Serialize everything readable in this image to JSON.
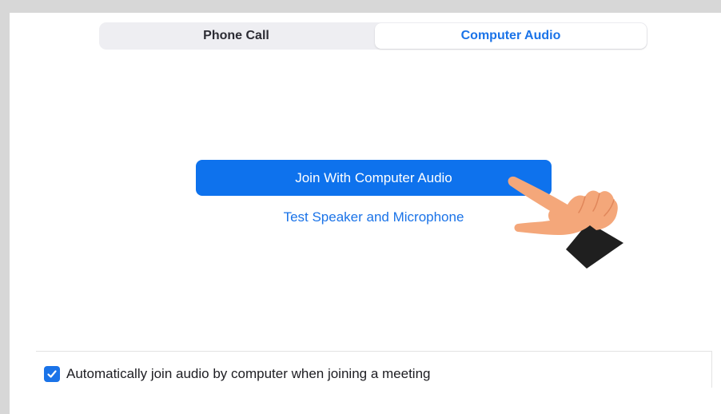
{
  "tabs": {
    "phone_call": "Phone Call",
    "computer_audio": "Computer Audio",
    "selected": "Computer Audio"
  },
  "main": {
    "join_button_label": "Join With Computer Audio",
    "test_link_label": "Test Speaker and Microphone"
  },
  "footer": {
    "auto_join_checked": true,
    "auto_join_label": "Automatically join audio by computer when joining a meeting"
  },
  "colors": {
    "accent": "#0e72ed",
    "link": "#1a73e8",
    "tab_bg": "#eeeef2",
    "hand_skin": "#f4a77a",
    "cuff": "#1f1f1f"
  },
  "icons": {
    "checkbox": "checkmark-icon",
    "pointer": "pointing-hand-icon"
  }
}
